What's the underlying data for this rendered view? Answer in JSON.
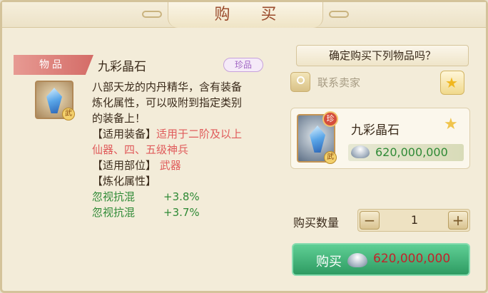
{
  "dialog": {
    "title": "购 买"
  },
  "item": {
    "category_label": "物品",
    "name": "九彩晶石",
    "rarity_label": "珍品",
    "type_badge": "武",
    "description_lines": [
      "八部天龙的内丹精华，含有装备",
      "炼化属性，可以吸附到指定类别",
      "的装备上！"
    ],
    "equip_type_label": "【适用装备】",
    "equip_type_value_line1": "适用于二阶及以上",
    "equip_type_value_line2": "仙器、四、五级神兵",
    "slot_label": "【适用部位】",
    "slot_value": "武器",
    "refine_label": "【炼化属性】",
    "stats": [
      {
        "name": "忽视抗混",
        "value": "+3.8%"
      },
      {
        "name": "忽视抗混",
        "value": "+3.7%"
      }
    ]
  },
  "purchase": {
    "confirm_text": "确定购买下列物品吗？",
    "contact_seller": "联系卖家",
    "card_item_name": "九彩晶石",
    "card_rarity_badge": "珍",
    "card_type_badge": "武",
    "price": "620,000,000",
    "quantity_label": "购买数量",
    "quantity": "1",
    "minus": "−",
    "plus": "+",
    "buy_label": "购买",
    "buy_price": "620,000,000"
  },
  "colors": {
    "accent_red": "#e05b5b",
    "stat_green": "#2f8a36",
    "buy_green": "#2e9b62",
    "price_red": "#c2232a"
  },
  "icons": [
    "crystal-icon",
    "silver-ingot-icon",
    "star-icon",
    "contact-icon"
  ]
}
